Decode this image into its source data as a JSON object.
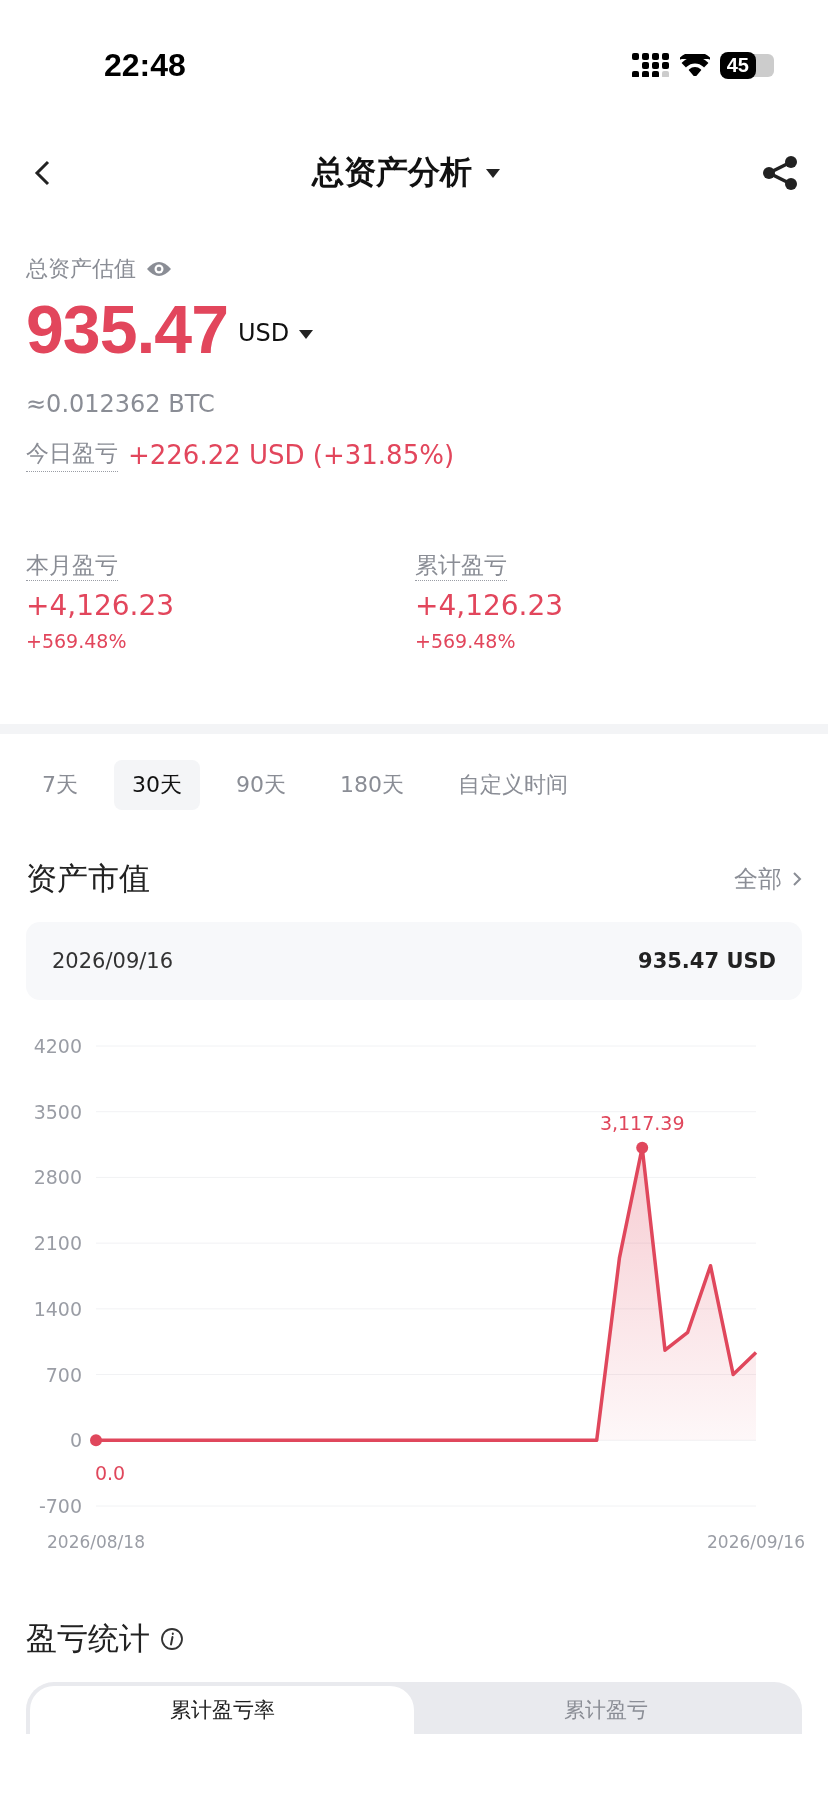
{
  "status_bar": {
    "time": "22:48",
    "battery": "45"
  },
  "nav": {
    "title": "总资产分析"
  },
  "summary": {
    "label": "总资产估值",
    "value": "935.47",
    "currency": "USD",
    "btc": "≈0.012362 BTC",
    "today_label": "今日盈亏",
    "today_value": "+226.22 USD (+31.85%)"
  },
  "stats": [
    {
      "label": "本月盈亏",
      "value": "+4,126.23",
      "percent": "+569.48%"
    },
    {
      "label": "累计盈亏",
      "value": "+4,126.23",
      "percent": "+569.48%"
    }
  ],
  "period_tabs": [
    {
      "label": "7天",
      "selected": false
    },
    {
      "label": "30天",
      "selected": true
    },
    {
      "label": "90天",
      "selected": false
    },
    {
      "label": "180天",
      "selected": false
    },
    {
      "label": "自定义时间",
      "selected": false
    }
  ],
  "asset_value": {
    "title": "资产市值",
    "link": "全部",
    "tooltip": {
      "date": "2026/09/16",
      "value": "935.47 USD"
    },
    "chart_data": {
      "type": "line",
      "grid": true,
      "categories": [
        "2026/08/18",
        null,
        null,
        null,
        null,
        null,
        null,
        null,
        null,
        null,
        null,
        null,
        null,
        null,
        null,
        null,
        null,
        null,
        null,
        null,
        null,
        null,
        null,
        null,
        null,
        null,
        null,
        null,
        null,
        "2026/09/16"
      ],
      "series": [
        {
          "color": "#e0475c",
          "values": [
            0,
            0,
            0,
            0,
            0,
            0,
            0,
            0,
            0,
            0,
            0,
            0,
            0,
            0,
            0,
            0,
            0,
            0,
            0,
            0,
            0,
            0,
            0,
            1940,
            3117.39,
            960,
            1150,
            1860,
            700,
            935.47
          ]
        }
      ],
      "ylim": [
        -700,
        4200
      ],
      "yticks": [
        4200,
        3500,
        2800,
        2100,
        1400,
        700,
        0,
        -700
      ],
      "annotations": [
        {
          "y": 0,
          "text": "0.0"
        },
        {
          "y": 3117.39,
          "text": "3,117.39"
        }
      ]
    }
  },
  "pnl": {
    "title": "盈亏统计",
    "tabs": [
      {
        "label": "累计盈亏率",
        "selected": true
      },
      {
        "label": "累计盈亏",
        "selected": false
      }
    ]
  }
}
